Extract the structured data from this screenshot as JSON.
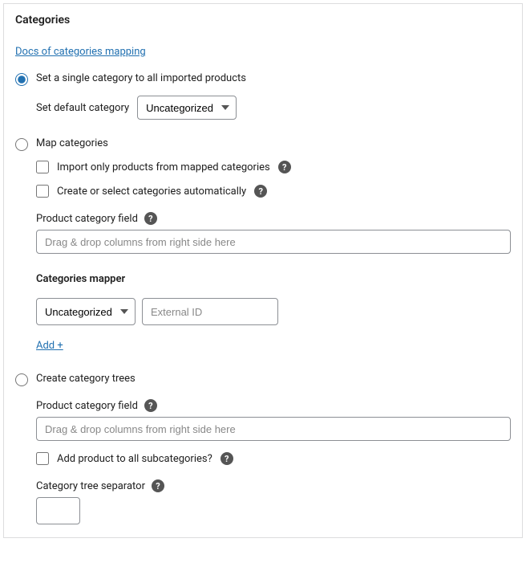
{
  "title": "Categories",
  "docs_link": "Docs of categories mapping",
  "options": {
    "single": {
      "label": "Set a single category to all imported products",
      "default_label": "Set default category",
      "default_value": "Uncategorized"
    },
    "map": {
      "label": "Map categories",
      "import_only": "Import only products from mapped categories",
      "auto_create": "Create or select categories automatically",
      "field_label": "Product category field",
      "field_placeholder": "Drag & drop columns from right side here",
      "mapper_heading": "Categories mapper",
      "mapper_category": "Uncategorized",
      "mapper_external_placeholder": "External ID",
      "add": "Add +"
    },
    "tree": {
      "label": "Create category trees",
      "field_label": "Product category field",
      "field_placeholder": "Drag & drop columns from right side here",
      "subcats": "Add product to all subcategories?",
      "separator_label": "Category tree separator"
    }
  }
}
